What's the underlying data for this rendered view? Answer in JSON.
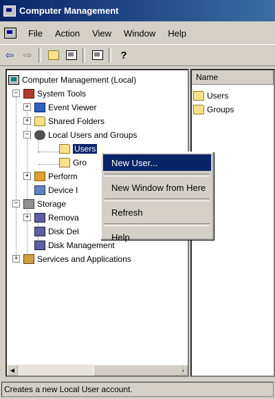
{
  "window": {
    "title": "Computer Management"
  },
  "menu": [
    "File",
    "Action",
    "View",
    "Window",
    "Help"
  ],
  "toolbar": {
    "buttons": [
      "back-arrow-icon",
      "forward-arrow-icon",
      "up-folder-icon",
      "show-hide-tree-icon",
      "export-list-icon",
      "help-icon"
    ]
  },
  "tree": {
    "root": "Computer Management (Local)",
    "system_tools": "System Tools",
    "event_viewer": "Event Viewer",
    "shared_folders": "Shared Folders",
    "local_users": "Local Users and Groups",
    "users": "Users",
    "groups_partial": "Gro",
    "performance_partial": "Perform",
    "device_partial": "Device I",
    "storage": "Storage",
    "removable_partial": "Remova",
    "disk_def_partial": "Disk Del",
    "disk_management": "Disk Management",
    "services": "Services and Applications"
  },
  "list": {
    "column": "Name",
    "items": [
      "Users",
      "Groups"
    ]
  },
  "context_menu": {
    "items": [
      "New User...",
      "New Window from Here",
      "Refresh",
      "Help"
    ]
  },
  "status": {
    "text": "Creates a new Local User account."
  }
}
